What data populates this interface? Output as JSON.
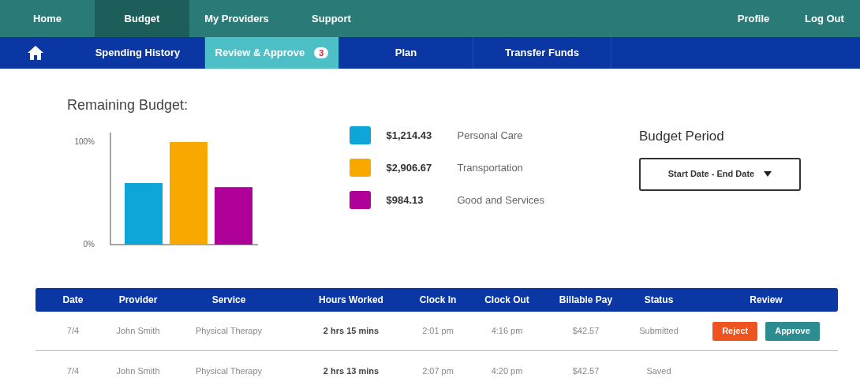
{
  "top_nav": {
    "items": [
      {
        "label": "Home",
        "selected": false
      },
      {
        "label": "Budget",
        "selected": true
      },
      {
        "label": "My Providers",
        "selected": false
      },
      {
        "label": "Support",
        "selected": false
      }
    ],
    "right_items": [
      "Profile",
      "Log Out"
    ]
  },
  "sub_nav": {
    "items": [
      {
        "label": "Spending History",
        "selected": false
      },
      {
        "label": "Review & Approve",
        "selected": true,
        "badge": "3"
      },
      {
        "label": "Plan",
        "selected": false
      },
      {
        "label": "Transfer Funds",
        "selected": false
      }
    ]
  },
  "budget": {
    "title": "Remaining Budget:",
    "chart_data": {
      "type": "bar",
      "categories": [
        null,
        null,
        null
      ],
      "values": [
        0.6,
        1.0,
        0.56
      ],
      "ylim": [
        0,
        1
      ],
      "yticks": [
        {
          "value": 0,
          "label": "0%"
        },
        {
          "value": 1,
          "label": "100%"
        }
      ]
    },
    "legend": [
      {
        "amount": "$1,214.43",
        "label": "Personal Care",
        "color": "#0ea5d8"
      },
      {
        "amount": "$2,906.67",
        "label": "Transportation",
        "color": "#f9a800"
      },
      {
        "amount": "$984.13",
        "label": "Good and Services",
        "color": "#b0009a"
      }
    ]
  },
  "budget_period": {
    "title": "Budget Period",
    "select": "Start Date - End Date"
  },
  "table": {
    "columns": [
      "Date",
      "Provider",
      "Service",
      "Hours Worked",
      "Clock In",
      "Clock Out",
      "Billable Pay",
      "Status",
      "Review"
    ],
    "rows": [
      {
        "cells": [
          "7/4",
          "John Smith",
          "Physical Therapy",
          "2 hrs 15 mins",
          "2:01 pm",
          "4:16 pm",
          "$42.57",
          "Submitted"
        ],
        "actions": [
          {
            "label": "Reject",
            "kind": "reject"
          },
          {
            "label": "Approve",
            "kind": "approve"
          }
        ]
      },
      {
        "cells": [
          "7/4",
          "John Smith",
          "Physical Therapy",
          "2 hrs 13 mins",
          "2:07 pm",
          "4:20 pm",
          "$42.57",
          "Saved"
        ],
        "actions": []
      }
    ]
  }
}
